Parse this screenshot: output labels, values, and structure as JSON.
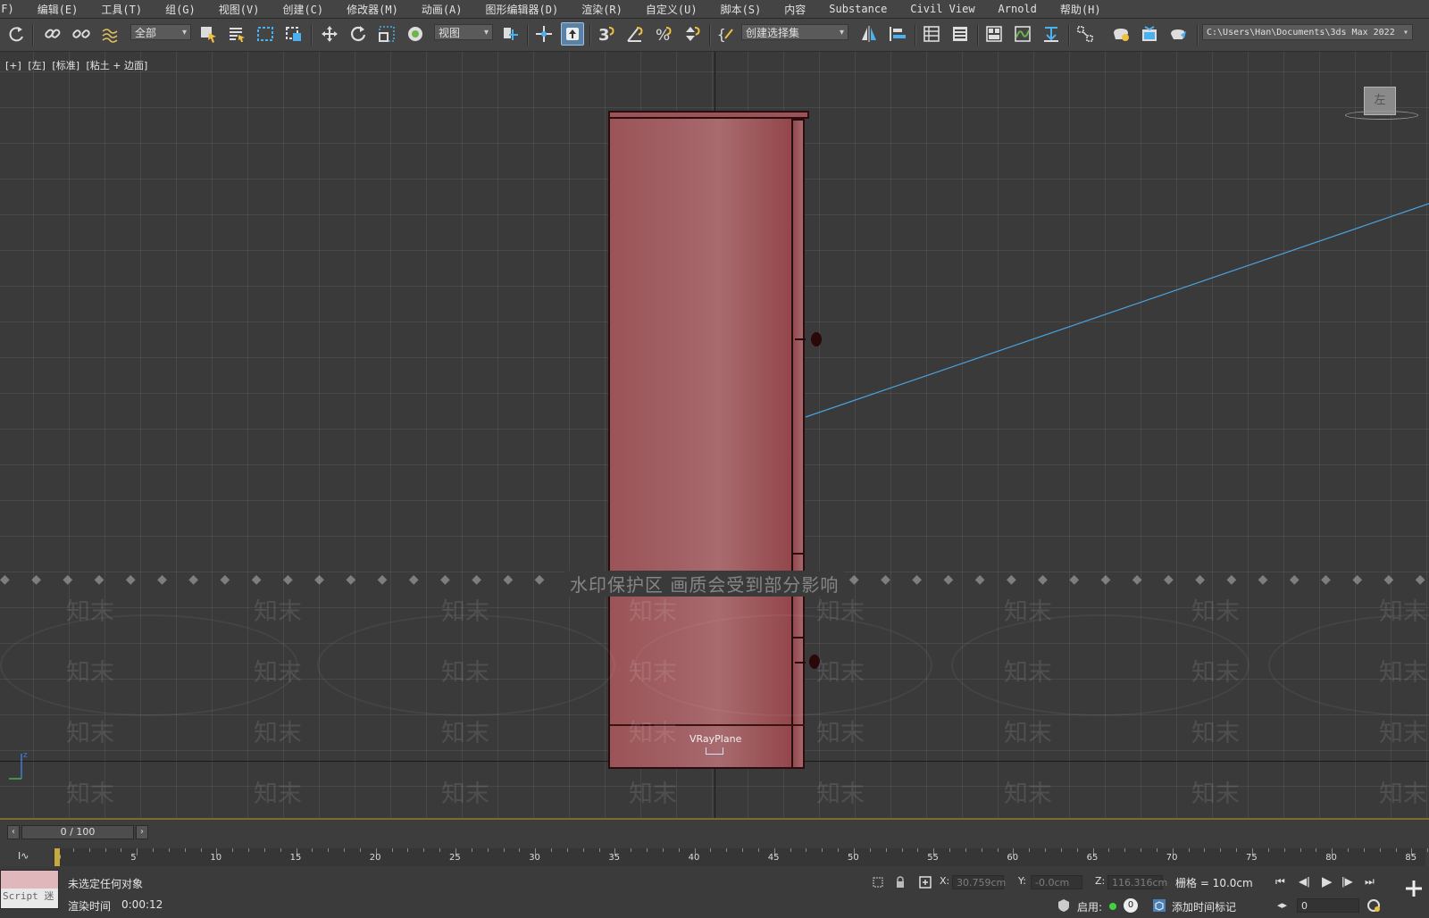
{
  "menu": [
    "(F)",
    "编辑(E)",
    "工具(T)",
    "组(G)",
    "视图(V)",
    "创建(C)",
    "修改器(M)",
    "动画(A)",
    "图形编辑器(D)",
    "渲染(R)",
    "自定义(U)",
    "脚本(S)",
    "内容",
    "Substance",
    "Civil View",
    "Arnold",
    "帮助(H)"
  ],
  "toolbar": {
    "selection_filter": "全部",
    "ref_coord": "视图",
    "named_selection": "创建选择集",
    "project_path": "C:\\Users\\Han\\Documents\\3ds Max 2022"
  },
  "viewport": {
    "labels": [
      "[+]",
      "[左]",
      "[标准]",
      "[粘土 + 边面]"
    ],
    "viewcube_face": "左",
    "object_label": "VRayPlane",
    "watermark_center": "水印保护区   画质会受到部分影响",
    "watermark_text": "知末",
    "accent_line_color": "#4aa3df"
  },
  "timeline": {
    "frame_display": "0 / 100",
    "ticks": [
      "0",
      "5",
      "10",
      "15",
      "20",
      "25",
      "30",
      "35",
      "40",
      "45",
      "50",
      "55",
      "60",
      "65",
      "70",
      "75",
      "80",
      "85"
    ]
  },
  "status": {
    "script_label": "Script 迷",
    "selection_msg": "未选定任何对象",
    "render_time_label": "渲染时间",
    "render_time_value": "0:00:12",
    "x_label": "X:",
    "x_value": "30.759cm",
    "y_label": "Y:",
    "y_value": "-0.0cm",
    "z_label": "Z:",
    "z_value": "116.316cm",
    "grid": "栅格 = 10.0cm",
    "enable_label": "启用:",
    "enable_count": "0",
    "add_time_tag": "添加时间标记",
    "frame_field": "0"
  }
}
